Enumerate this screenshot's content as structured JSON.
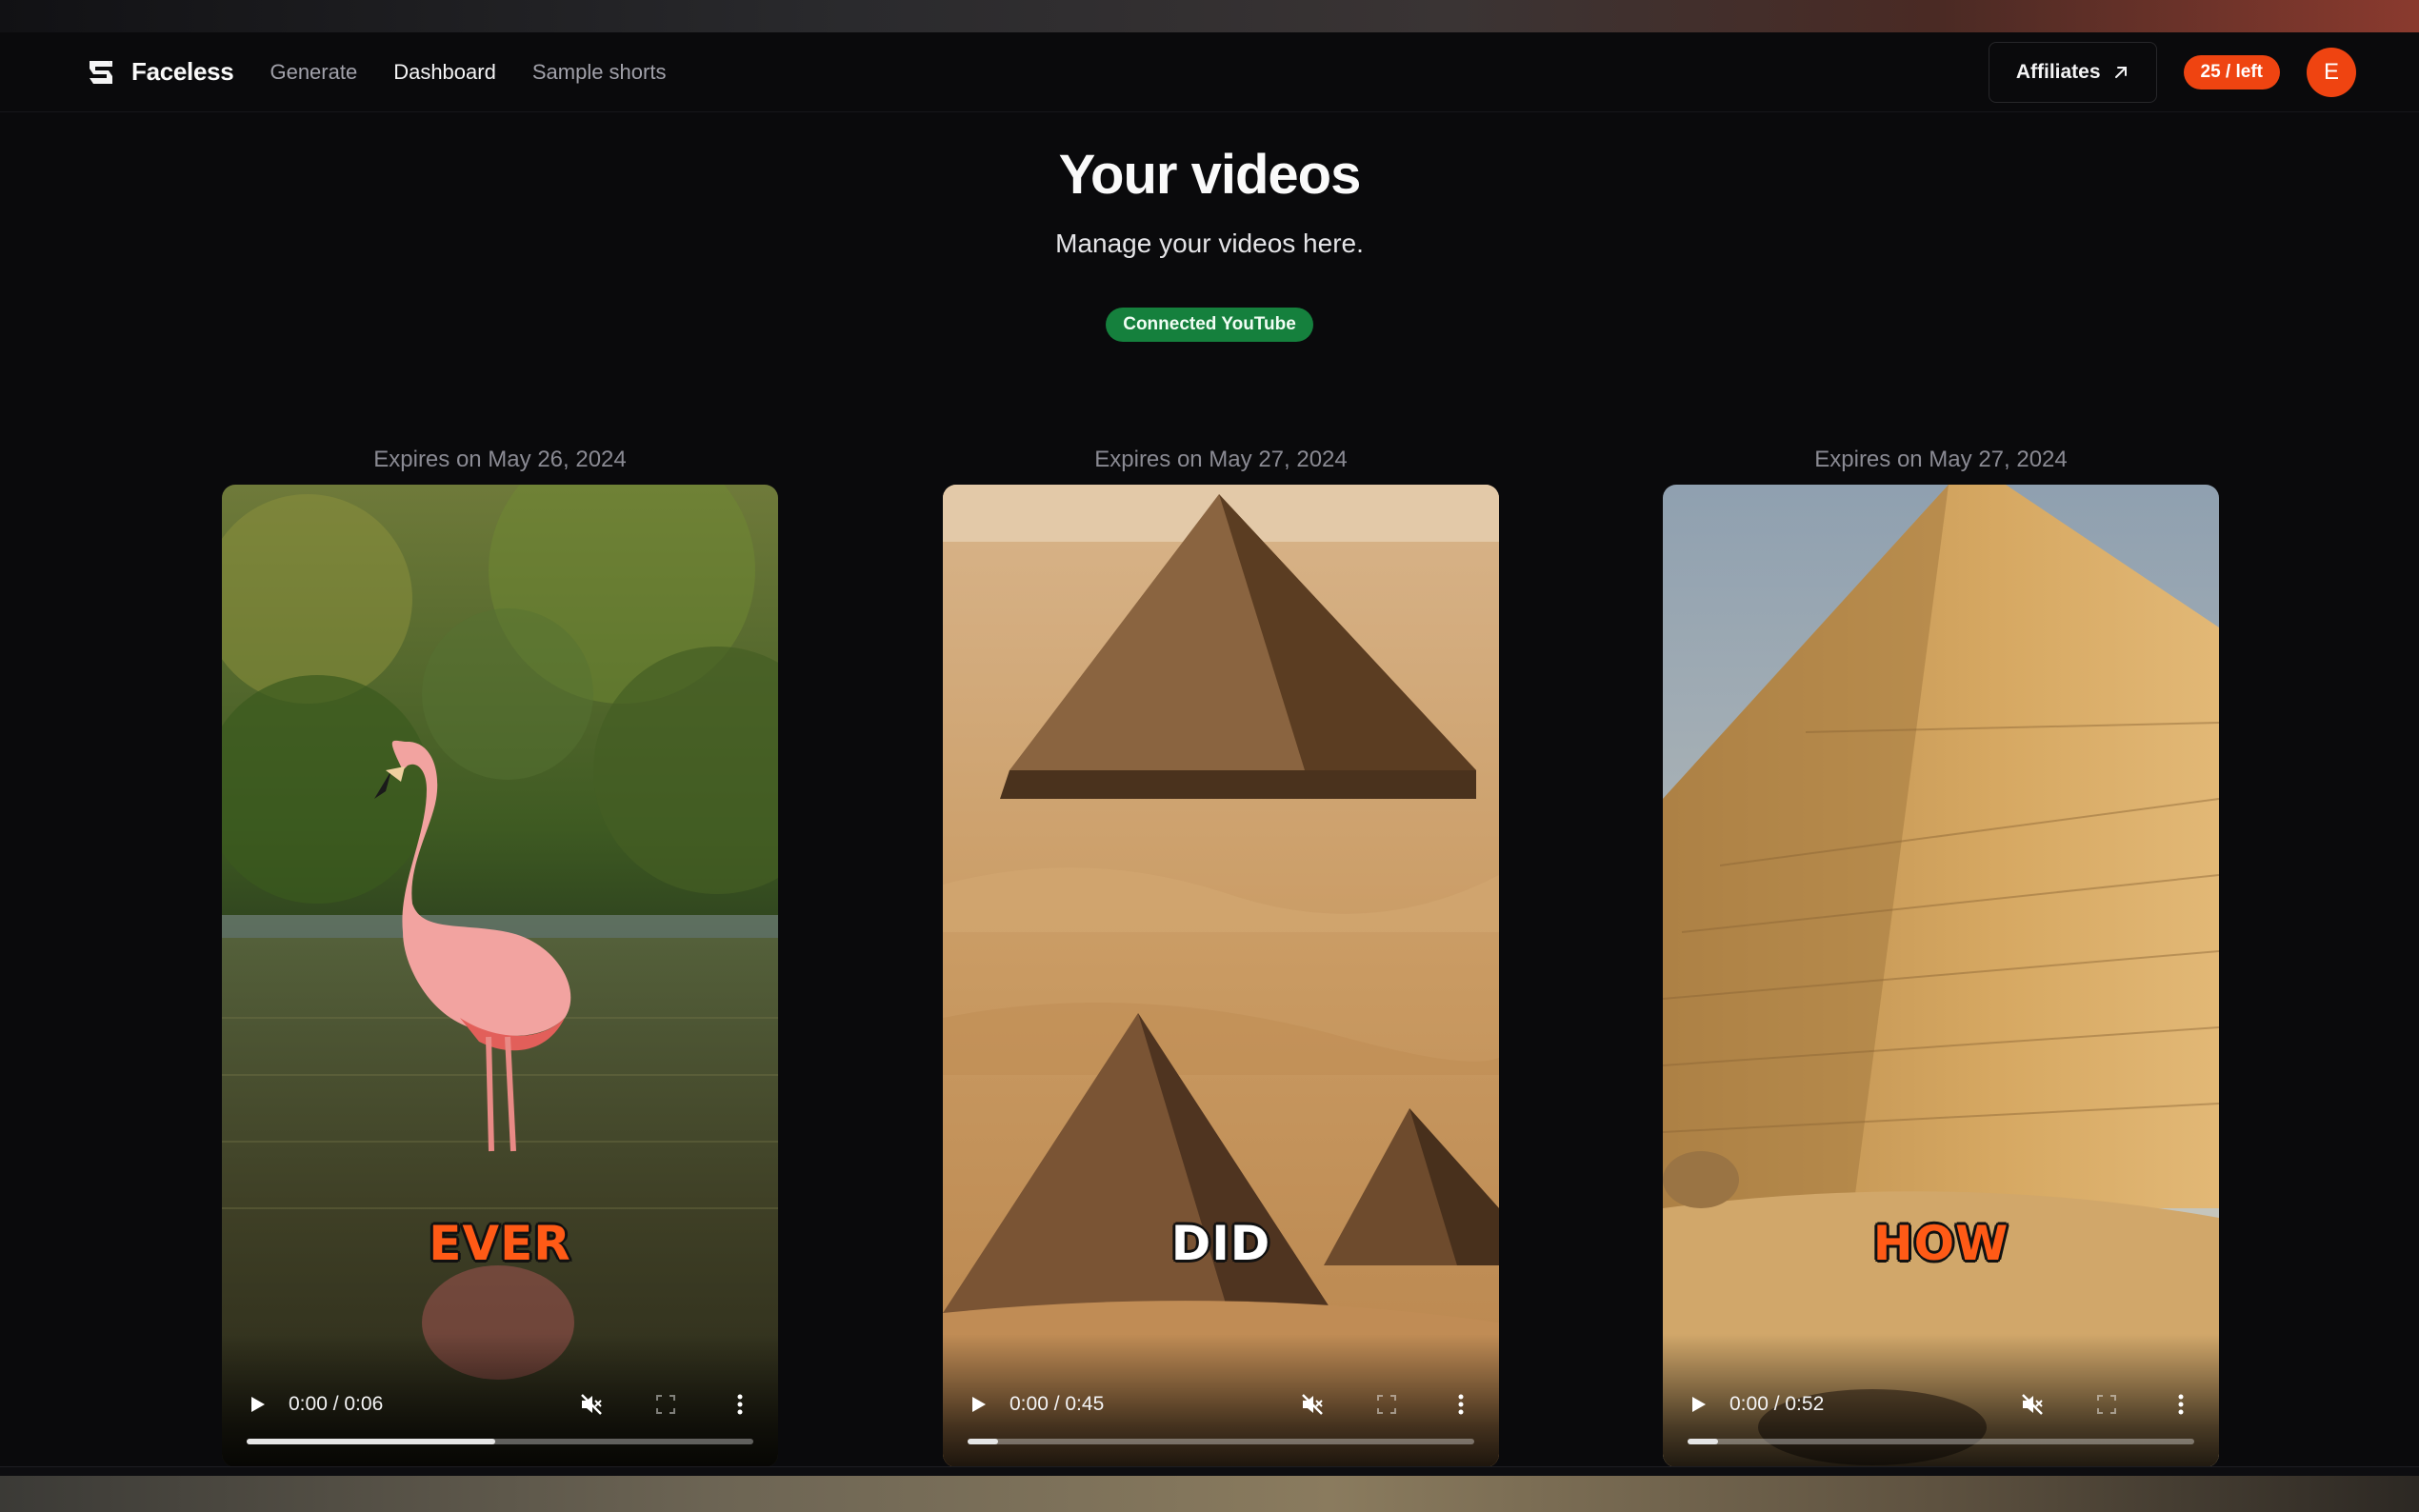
{
  "navbar": {
    "brand": "Faceless",
    "links": [
      {
        "label": "Generate",
        "active": false
      },
      {
        "label": "Dashboard",
        "active": true
      },
      {
        "label": "Sample shorts",
        "active": false
      }
    ],
    "affiliates_label": "Affiliates",
    "credits_label": "25 / left",
    "avatar_initial": "E",
    "accent_color": "#ef4411"
  },
  "header": {
    "title": "Your videos",
    "subtitle": "Manage your videos here.",
    "youtube_badge": "Connected YouTube",
    "badge_color": "#15803d"
  },
  "videos": [
    {
      "expires": "Expires on May 26, 2024",
      "caption": "EVER",
      "caption_color": "orange",
      "scene": "flamingo in lagoon",
      "time": "0:00 / 0:06",
      "buffered_fraction": 0.49
    },
    {
      "expires": "Expires on May 27, 2024",
      "caption": "DID",
      "caption_color": "white",
      "scene": "pyramids in desert",
      "time": "0:00 / 0:45",
      "buffered_fraction": 0.06
    },
    {
      "expires": "Expires on May 27, 2024",
      "caption": "HOW",
      "caption_color": "orange",
      "scene": "great pyramid close-up",
      "time": "0:00 / 0:52",
      "buffered_fraction": 0.06
    }
  ],
  "icons": {
    "logo": "faceless-logo-icon",
    "affiliates": "arrow-up-right-icon",
    "play": "play-icon",
    "mute": "muted-speaker-icon",
    "fullscreen": "fullscreen-icon",
    "more": "more-vertical-icon"
  }
}
